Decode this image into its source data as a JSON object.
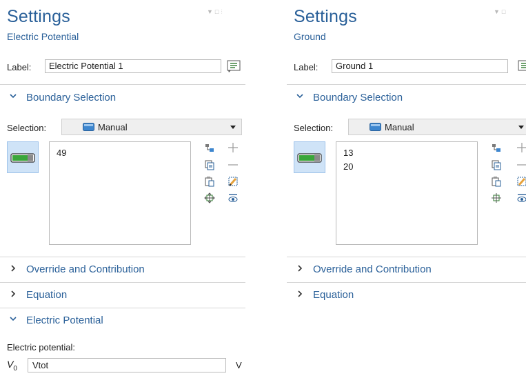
{
  "left": {
    "title": "Settings",
    "subtitle": "Electric Potential",
    "label_caption": "Label:",
    "label_value": "Electric Potential 1",
    "boundary_section": "Boundary Selection",
    "selection_caption": "Selection:",
    "selection_value": "Manual",
    "boundaries": [
      "49"
    ],
    "sections": [
      "Override and Contribution",
      "Equation",
      "Electric Potential"
    ],
    "potential_caption": "Electric potential:",
    "potential_symbol": "V",
    "potential_subscript": "0",
    "potential_value": "Vtot",
    "potential_unit": "V"
  },
  "right": {
    "title": "Settings",
    "subtitle": "Ground",
    "label_caption": "Label:",
    "label_value": "Ground 1",
    "boundary_section": "Boundary Selection",
    "selection_caption": "Selection:",
    "selection_value": "Manual",
    "boundaries": [
      "13",
      "20"
    ],
    "sections": [
      "Override and Contribution",
      "Equation"
    ]
  },
  "colors": {
    "accent": "#2a6099",
    "toggle_bg": "#cfe3f7",
    "toggle_green": "#3aa63a",
    "divider": "#d6d6d6"
  },
  "icons": {
    "window_controls": [
      "dropdown-icon",
      "maximize-icon",
      "pin-icon"
    ],
    "label_button": "edit-label-icon",
    "selection_type": "manual-domain-icon",
    "active_toggle": "active-toggle-icon",
    "tools": [
      "go-to-source-icon",
      "copy-icon",
      "paste-icon",
      "zoom-selected-icon",
      "add-icon",
      "remove-icon",
      "clear-selection-icon",
      "show-selection-icon"
    ]
  }
}
